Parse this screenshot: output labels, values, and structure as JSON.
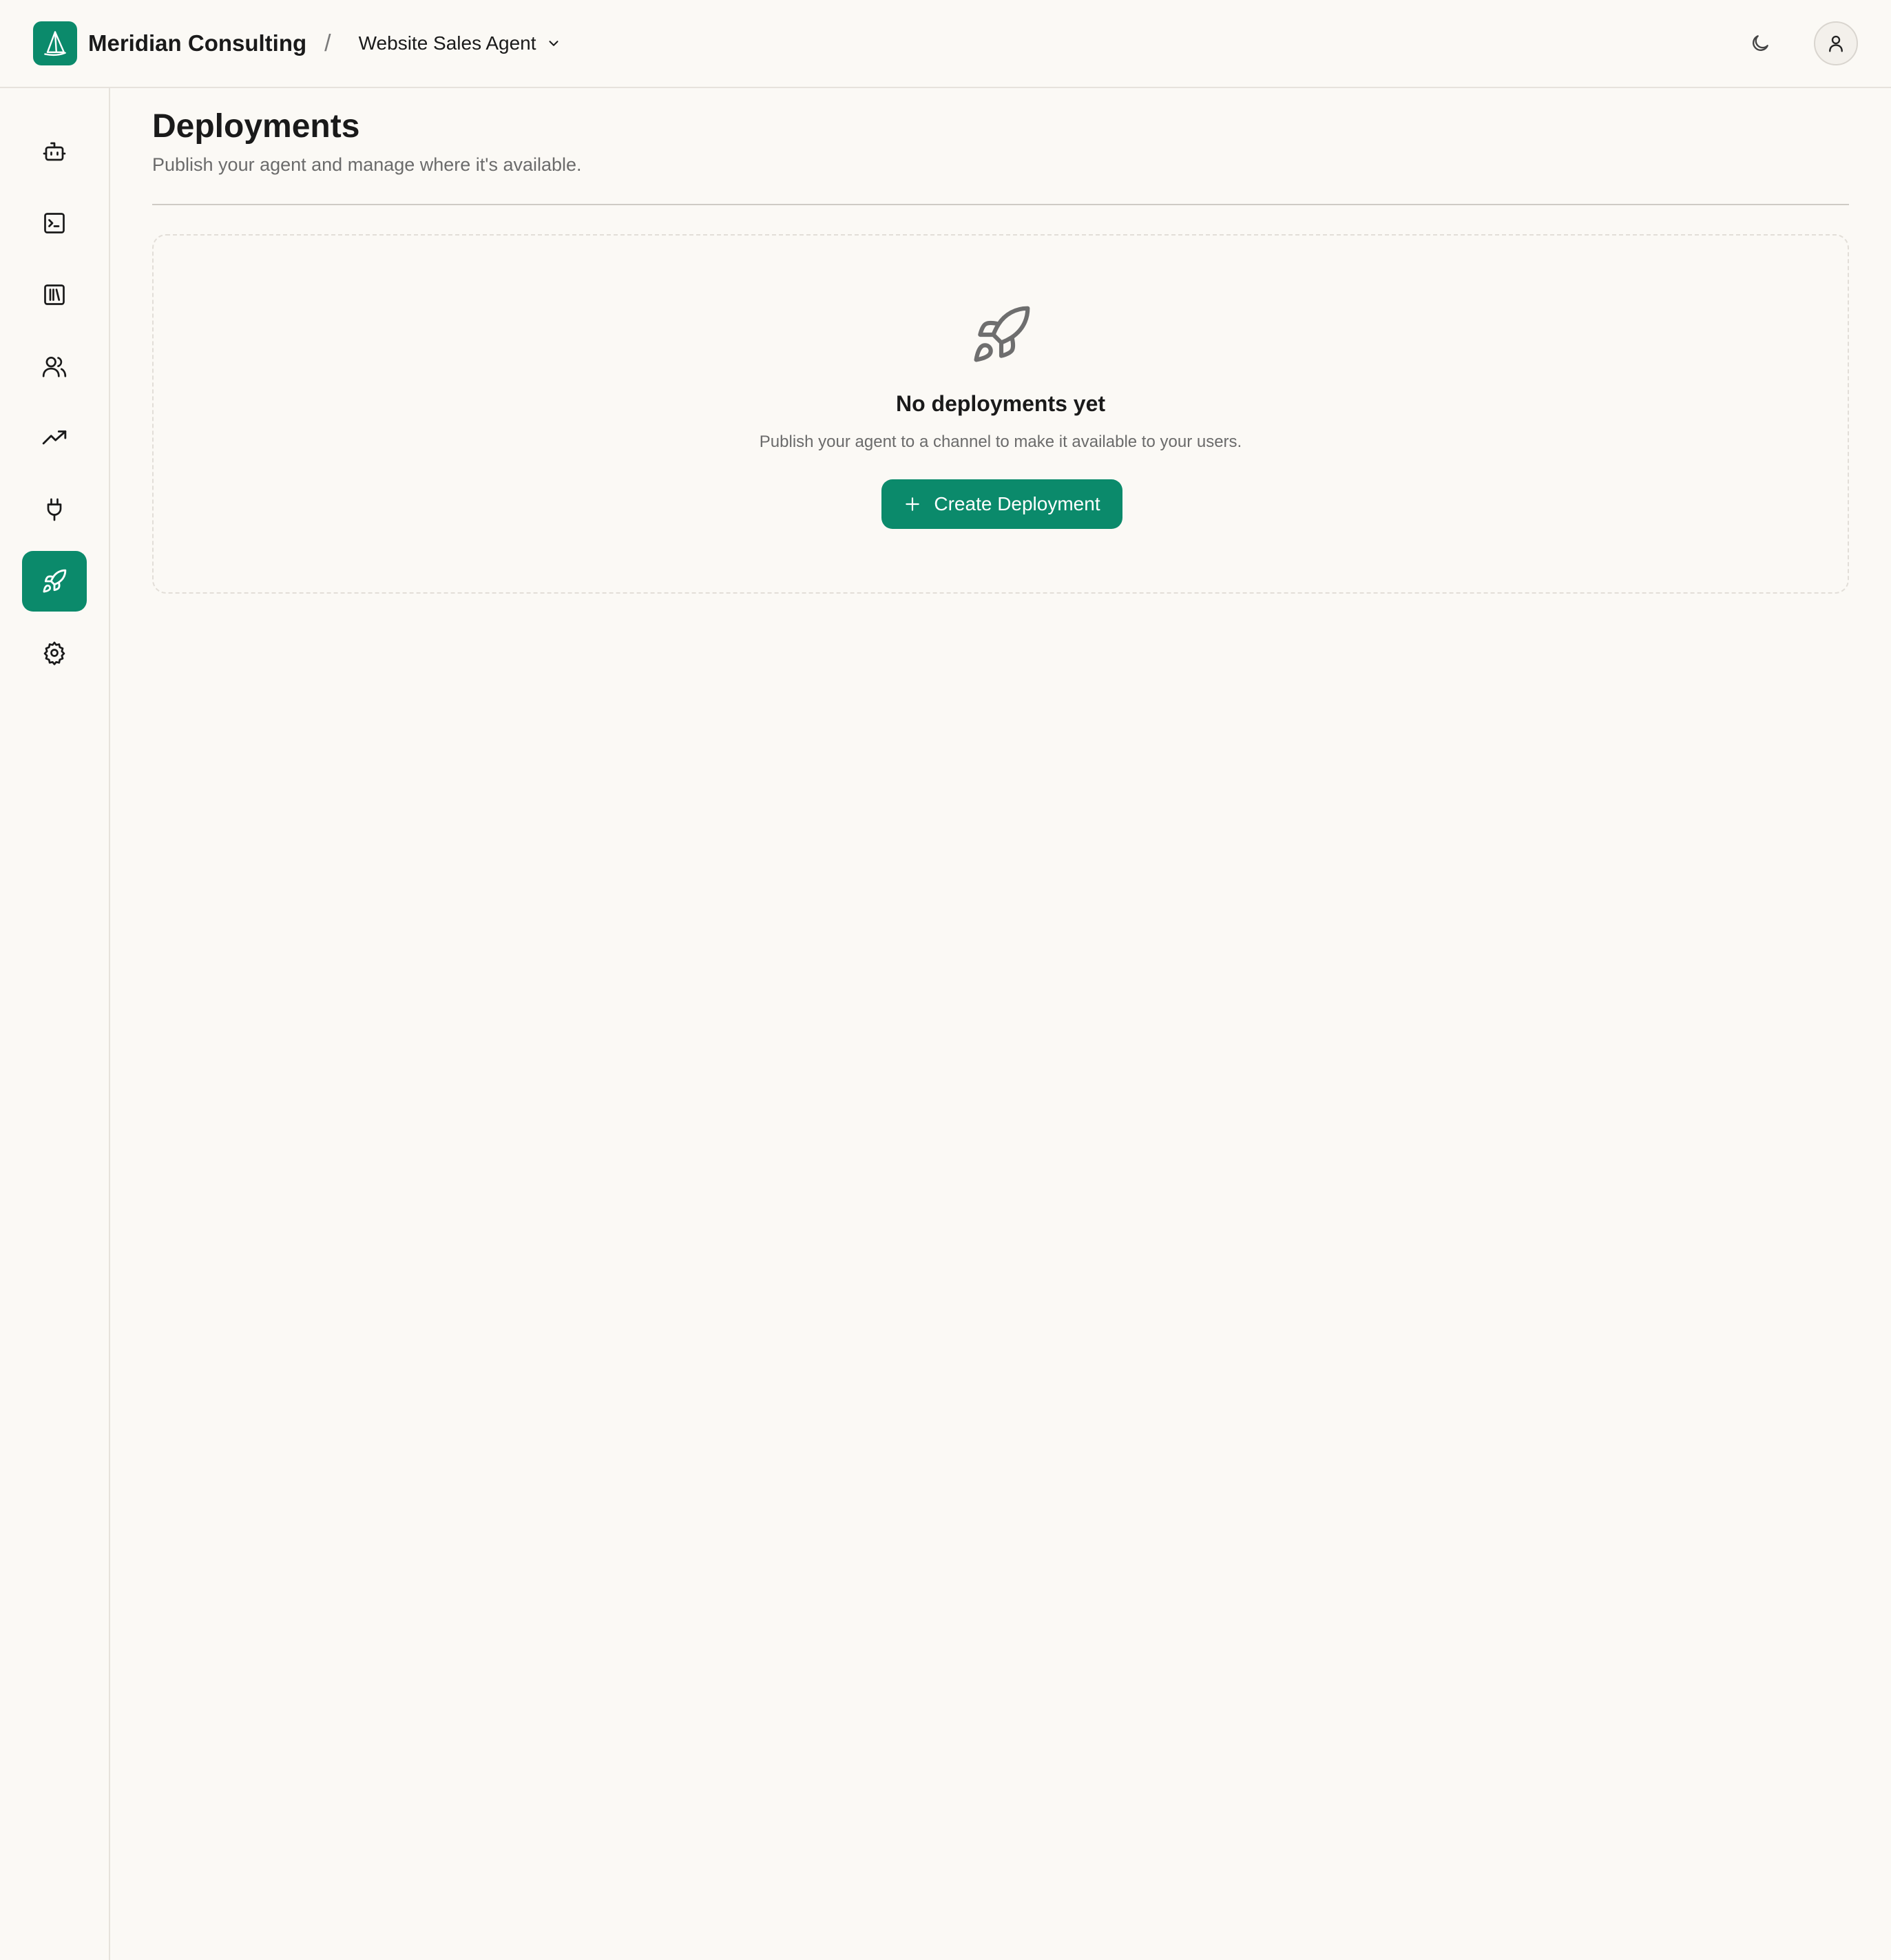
{
  "header": {
    "org_name": "Meridian Consulting",
    "separator": "/",
    "agent_name": "Website Sales Agent",
    "logo_icon": "sailboat-icon",
    "theme_toggle_icon": "moon-icon",
    "account_icon": "user-icon"
  },
  "sidebar": {
    "items": [
      {
        "icon": "bot-icon",
        "active": false
      },
      {
        "icon": "terminal-icon",
        "active": false
      },
      {
        "icon": "library-icon",
        "active": false
      },
      {
        "icon": "users-icon",
        "active": false
      },
      {
        "icon": "trending-up-icon",
        "active": false
      },
      {
        "icon": "plug-icon",
        "active": false
      },
      {
        "icon": "rocket-icon",
        "active": true
      },
      {
        "icon": "settings-gear-icon",
        "active": false
      }
    ]
  },
  "page": {
    "title": "Deployments",
    "subtitle": "Publish your agent and manage where it's available."
  },
  "empty_state": {
    "icon": "rocket-icon",
    "title": "No deployments yet",
    "description": "Publish your agent to a channel to make it available to your users.",
    "button_label": "Create Deployment",
    "button_icon": "plus-icon"
  },
  "colors": {
    "accent": "#0b8a6b",
    "background": "#fbf9f5",
    "border": "#e6e2dc",
    "text_primary": "#1a1a1a",
    "text_muted": "#6b6b6b"
  }
}
